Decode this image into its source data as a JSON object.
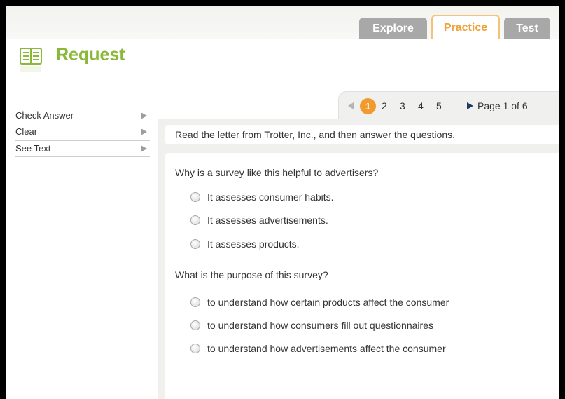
{
  "tabs": {
    "explore": "Explore",
    "practice": "Practice",
    "test": "Test"
  },
  "header": {
    "title": "Request",
    "icon": "book-icon",
    "accent_color": "#8ab838"
  },
  "menu": {
    "items": [
      {
        "label": "Check Answer"
      },
      {
        "label": "Clear"
      },
      {
        "label": "See Text"
      }
    ]
  },
  "pager": {
    "current": "1",
    "pages": [
      "2",
      "3",
      "4",
      "5"
    ],
    "page_label": "Page 1 of 6",
    "active_color": "#f29a2e"
  },
  "instruction": "Read the letter from Trotter, Inc., and then answer the questions.",
  "questions": [
    {
      "text": "Why is a survey like this helpful to advertisers?",
      "options": [
        "It assesses consumer habits.",
        "It assesses advertisements.",
        "It assesses products."
      ]
    },
    {
      "text": "What is the purpose of this survey?",
      "options": [
        "to understand how certain products affect the consumer",
        "to understand how consumers fill out questionnaires",
        "to understand how advertisements affect the consumer"
      ]
    }
  ]
}
